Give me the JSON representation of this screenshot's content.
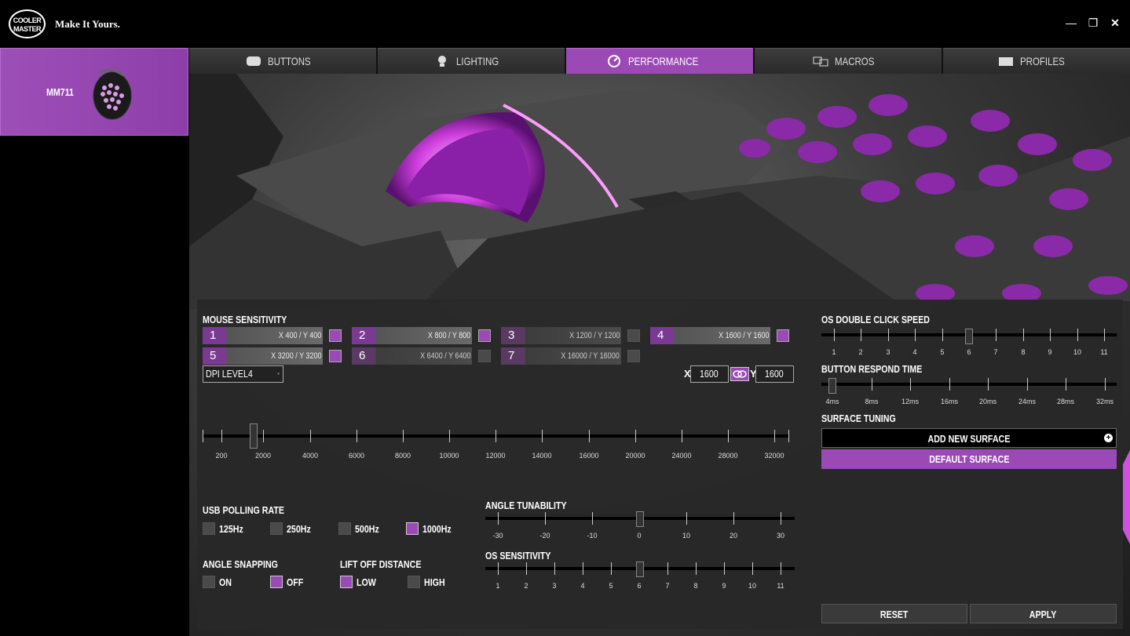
{
  "app": {
    "logo_line1": "COOLER",
    "logo_line2": "MASTER",
    "tagline": "Make It Yours."
  },
  "window": {
    "minimize_label": "—",
    "restore_label": "❐",
    "close_label": "✕"
  },
  "sidebar": {
    "device_name": "MM711"
  },
  "tabs": [
    {
      "label": "BUTTONS",
      "icon": "mouse-icon",
      "active": false
    },
    {
      "label": "LIGHTING",
      "icon": "bulb-icon",
      "active": false
    },
    {
      "label": "PERFORMANCE",
      "icon": "gauge-icon",
      "active": true
    },
    {
      "label": "MACROS",
      "icon": "macro-icon",
      "active": false
    },
    {
      "label": "PROFILES",
      "icon": "folder-icon",
      "active": false
    }
  ],
  "sensitivity": {
    "title": "MOUSE SENSITIVITY",
    "slots": [
      {
        "num": "1",
        "value": "X 400 / Y 400",
        "enabled": true,
        "color": "#9b4ab5"
      },
      {
        "num": "2",
        "value": "X 800 / Y 800",
        "enabled": true,
        "color": "#9b4ab5"
      },
      {
        "num": "3",
        "value": "X 1200 / Y 1200",
        "enabled": false,
        "color": "#4a4a4a"
      },
      {
        "num": "4",
        "value": "X 1600 / Y 1600",
        "enabled": true,
        "color": "#9b4ab5"
      },
      {
        "num": "5",
        "value": "X 3200 / Y 3200",
        "enabled": true,
        "color": "#9b4ab5"
      },
      {
        "num": "6",
        "value": "X 6400 / Y 6400",
        "enabled": false,
        "color": "#4a4a4a"
      },
      {
        "num": "7",
        "value": "X 16000 / Y 16000",
        "enabled": false,
        "color": "#4a4a4a"
      }
    ],
    "dpi_level": "DPI LEVEL4",
    "x_label": "X",
    "x_value": "1600",
    "y_label": "Y",
    "y_value": "1600",
    "scale": [
      "200",
      "2000",
      "4000",
      "6000",
      "8000",
      "10000",
      "12000",
      "14000",
      "16000",
      "20000",
      "24000",
      "28000",
      "32000"
    ],
    "current": "1600"
  },
  "polling": {
    "title": "USB POLLING RATE",
    "options": [
      {
        "label": "125Hz",
        "checked": false
      },
      {
        "label": "250Hz",
        "checked": false
      },
      {
        "label": "500Hz",
        "checked": false
      },
      {
        "label": "1000Hz",
        "checked": true
      }
    ]
  },
  "angle_snapping": {
    "title": "ANGLE SNAPPING",
    "options": [
      {
        "label": "ON",
        "checked": false
      },
      {
        "label": "OFF",
        "checked": true
      }
    ]
  },
  "lift_off": {
    "title": "LIFT OFF DISTANCE",
    "options": [
      {
        "label": "LOW",
        "checked": true
      },
      {
        "label": "HIGH",
        "checked": false
      }
    ]
  },
  "angle_tunability": {
    "title": "ANGLE TUNABILITY",
    "scale": [
      "-30",
      "-20",
      "-10",
      "0",
      "10",
      "20",
      "30"
    ],
    "value": "0"
  },
  "os_sensitivity": {
    "title": "OS SENSITIVITY",
    "scale": [
      "1",
      "2",
      "3",
      "4",
      "5",
      "6",
      "7",
      "8",
      "9",
      "10",
      "11"
    ],
    "value": "6"
  },
  "double_click": {
    "title": "OS DOUBLE CLICK SPEED",
    "scale": [
      "1",
      "2",
      "3",
      "4",
      "5",
      "6",
      "7",
      "8",
      "9",
      "10",
      "11"
    ],
    "value": "6"
  },
  "respond_time": {
    "title": "BUTTON RESPOND TIME",
    "scale": [
      "4ms",
      "8ms",
      "12ms",
      "16ms",
      "20ms",
      "24ms",
      "28ms",
      "32ms"
    ],
    "value": "4ms"
  },
  "surface": {
    "title": "SURFACE TUNING",
    "add_label": "ADD NEW SURFACE",
    "default_label": "DEFAULT SURFACE"
  },
  "actions": {
    "reset": "RESET",
    "apply": "APPLY"
  },
  "colors": {
    "accent": "#9b4ab5",
    "panel": "#282828"
  }
}
